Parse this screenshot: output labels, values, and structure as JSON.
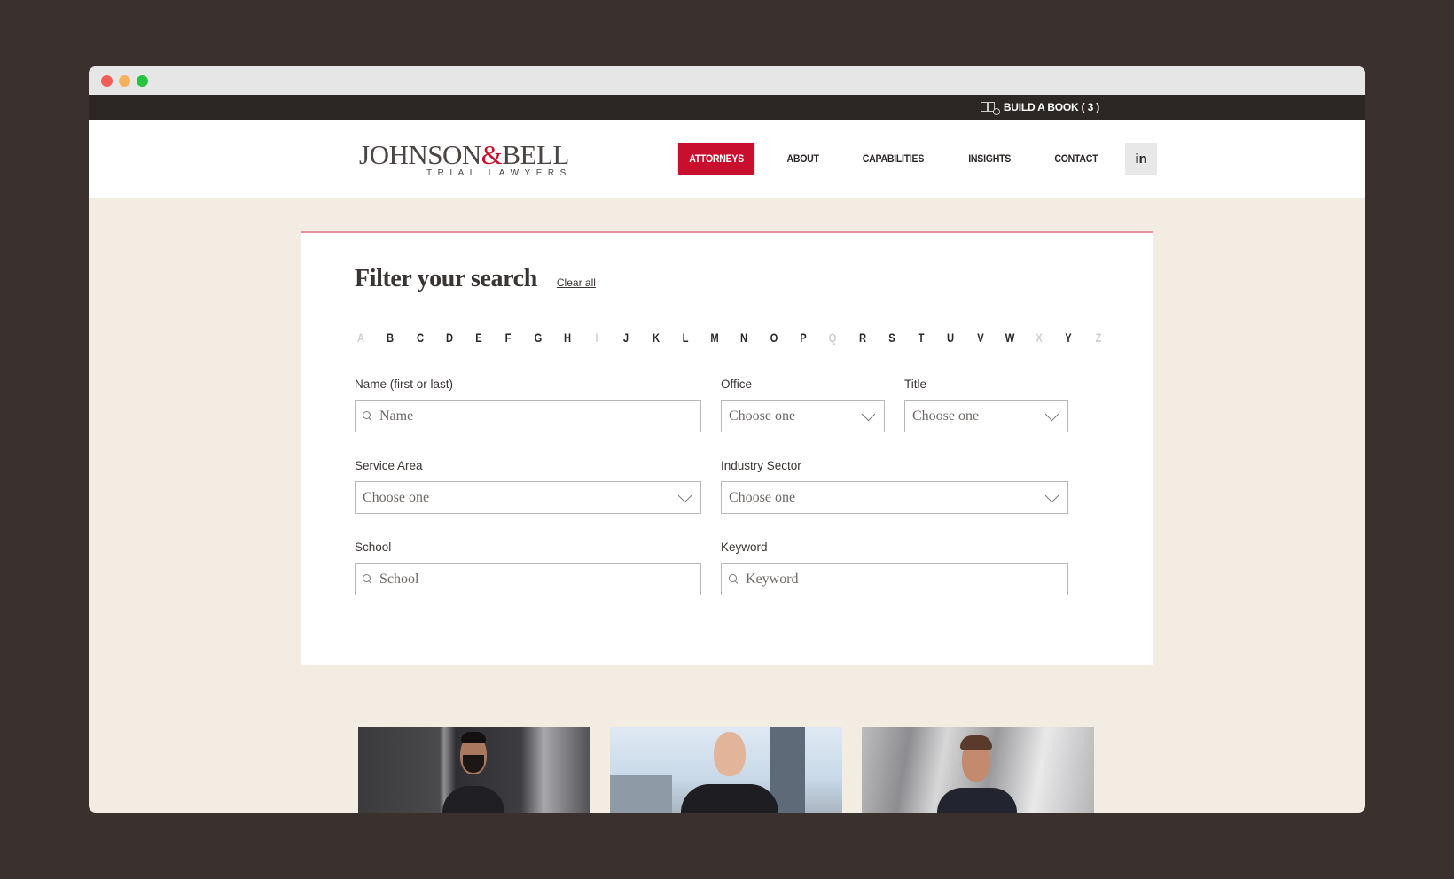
{
  "topbar": {
    "build_book_label": "BUILD A BOOK ( 3 )"
  },
  "header": {
    "logo": {
      "main_left": "JOHNSON",
      "amp": "&",
      "main_right": "BELL",
      "sub": "TRIAL LAWYERS"
    },
    "nav": [
      {
        "label": "ATTORNEYS",
        "active": true
      },
      {
        "label": "ABOUT",
        "active": false
      },
      {
        "label": "CAPABILITIES",
        "active": false
      },
      {
        "label": "INSIGHTS",
        "active": false
      },
      {
        "label": "CONTACT",
        "active": false
      }
    ],
    "linkedin_label": "in"
  },
  "filter": {
    "title": "Filter your search",
    "clear_all": "Clear all",
    "alphabet": [
      {
        "letter": "A",
        "enabled": false
      },
      {
        "letter": "B",
        "enabled": true
      },
      {
        "letter": "C",
        "enabled": true
      },
      {
        "letter": "D",
        "enabled": true
      },
      {
        "letter": "E",
        "enabled": true
      },
      {
        "letter": "F",
        "enabled": true
      },
      {
        "letter": "G",
        "enabled": true
      },
      {
        "letter": "H",
        "enabled": true
      },
      {
        "letter": "I",
        "enabled": false
      },
      {
        "letter": "J",
        "enabled": true
      },
      {
        "letter": "K",
        "enabled": true
      },
      {
        "letter": "L",
        "enabled": true
      },
      {
        "letter": "M",
        "enabled": true
      },
      {
        "letter": "N",
        "enabled": true
      },
      {
        "letter": "O",
        "enabled": true
      },
      {
        "letter": "P",
        "enabled": true
      },
      {
        "letter": "Q",
        "enabled": false
      },
      {
        "letter": "R",
        "enabled": true
      },
      {
        "letter": "S",
        "enabled": true
      },
      {
        "letter": "T",
        "enabled": true
      },
      {
        "letter": "U",
        "enabled": true
      },
      {
        "letter": "V",
        "enabled": true
      },
      {
        "letter": "W",
        "enabled": true
      },
      {
        "letter": "X",
        "enabled": false
      },
      {
        "letter": "Y",
        "enabled": true
      },
      {
        "letter": "Z",
        "enabled": false
      }
    ],
    "fields": {
      "name": {
        "label": "Name (first or last)",
        "placeholder": "Name",
        "value": ""
      },
      "office": {
        "label": "Office",
        "selected": "Choose one"
      },
      "title": {
        "label": "Title",
        "selected": "Choose one"
      },
      "service_area": {
        "label": "Service Area",
        "selected": "Choose one"
      },
      "industry_sector": {
        "label": "Industry Sector",
        "selected": "Choose one"
      },
      "school": {
        "label": "School",
        "placeholder": "School",
        "value": ""
      },
      "keyword": {
        "label": "Keyword",
        "placeholder": "Keyword",
        "value": ""
      }
    }
  },
  "attorney_cards": [
    {
      "photo": "attorney-photo-1"
    },
    {
      "photo": "attorney-photo-2"
    },
    {
      "photo": "attorney-photo-3"
    }
  ],
  "colors": {
    "brand_red": "#c8102e",
    "page_bg": "#f2ece2",
    "topbar_bg": "#2c2724"
  }
}
